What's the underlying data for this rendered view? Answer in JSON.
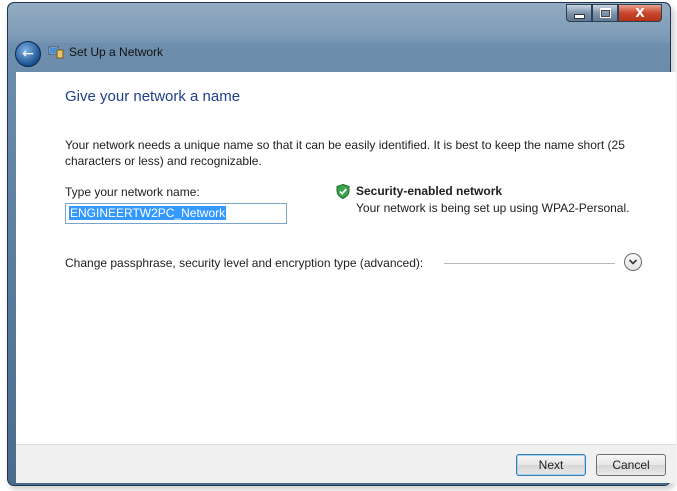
{
  "window": {
    "title": "Set Up a Network",
    "controls": {
      "minimize_icon": "minimize-icon",
      "maximize_icon": "maximize-icon",
      "close_label": "X"
    }
  },
  "nav": {
    "back_icon": "back-arrow-icon",
    "back_glyph": "←"
  },
  "page": {
    "heading": "Give your network a name",
    "description": "Your network needs a unique name so that it can be easily identified. It is best to keep the name short (25 characters or less) and recognizable.",
    "name_field": {
      "label": "Type your network name:",
      "value": "ENGINEERTW2PC_Network"
    },
    "security": {
      "icon": "shield-check-icon",
      "title": "Security-enabled network",
      "detail": "Your network is being set up using WPA2-Personal."
    },
    "advanced": {
      "label": "Change passphrase, security level and encryption type (advanced):",
      "expander_icon": "chevron-down-icon"
    }
  },
  "footer": {
    "next_label": "Next",
    "cancel_label": "Cancel"
  },
  "colors": {
    "heading": "#1e3f8a",
    "frame": "#5b7fa0",
    "close": "#c9462c",
    "selection": "#3399ff"
  }
}
